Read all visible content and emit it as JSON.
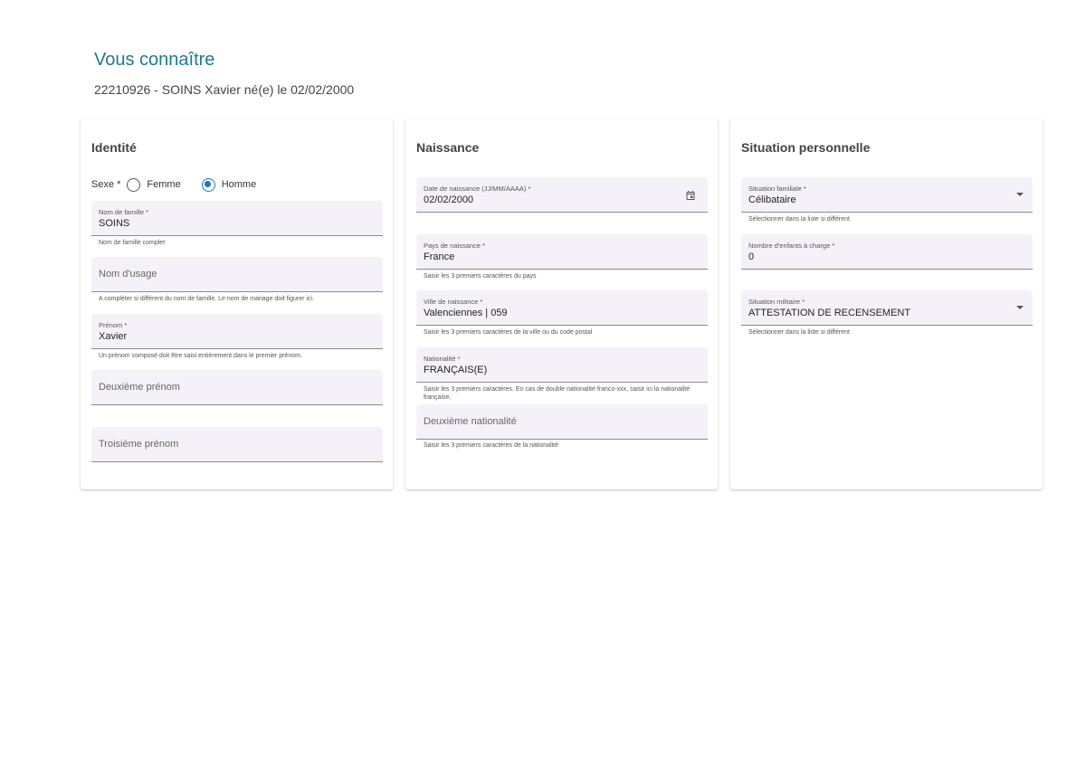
{
  "header": {
    "title": "Vous connaître",
    "subtitle": "22210926 - SOINS Xavier né(e) le 02/02/2000"
  },
  "identite": {
    "title": "Identité",
    "sexe": {
      "label": "Sexe *",
      "options": [
        {
          "label": "Femme",
          "checked": false
        },
        {
          "label": "Homme",
          "checked": true
        }
      ]
    },
    "nom_famille": {
      "label": "Nom de famille *",
      "value": "SOINS",
      "hint": "Nom de famille complet"
    },
    "nom_usage": {
      "placeholder": "Nom d'usage",
      "hint": "A compléter si différent du nom de famille. Le nom de mariage doit figurer ici."
    },
    "prenom": {
      "label": "Prénom *",
      "value": "Xavier",
      "hint": "Un prénom composé doit être saisi entièrement dans le premier prénom."
    },
    "deuxieme_prenom": {
      "placeholder": "Deuxième prénom"
    },
    "troisieme_prenom": {
      "placeholder": "Troisième prénom"
    }
  },
  "naissance": {
    "title": "Naissance",
    "date": {
      "label": "Date de naissance (JJ/MM/AAAA) *",
      "value": "02/02/2000",
      "icon": "calendar-icon"
    },
    "pays": {
      "label": "Pays de naissance *",
      "value": "France",
      "hint": "Saisir les 3 premiers caractères du pays"
    },
    "ville": {
      "label": "Ville de naissance *",
      "value": "Valenciennes | 059",
      "hint": "Saisir les 3 premiers caractères de la ville ou du code postal"
    },
    "nationalite": {
      "label": "Nationalité *",
      "value": "FRANÇAIS(E)",
      "hint": "Saisir les 3 premiers caractères. En cas de double nationalité franco-xxx, saisir ici la nationalité française."
    },
    "deuxieme_nationalite": {
      "placeholder": "Deuxième nationalité",
      "hint": "Saisir les 3 premiers caractères de la nationalité"
    }
  },
  "situation": {
    "title": "Situation personnelle",
    "familiale": {
      "label": "Situation familiale *",
      "value": "Célibataire",
      "hint": "Sélectionner dans la liste si différent"
    },
    "enfants": {
      "label": "Nombre d'enfants à charge *",
      "value": "0"
    },
    "militaire": {
      "label": "Situation militaire *",
      "value": "ATTESTATION DE RECENSEMENT",
      "hint": "Sélectionner dans la liste si différent"
    }
  },
  "colors": {
    "accent": "#1e7a8c",
    "radio": "#1a73c9",
    "field_bg": "#f4f2f8"
  }
}
